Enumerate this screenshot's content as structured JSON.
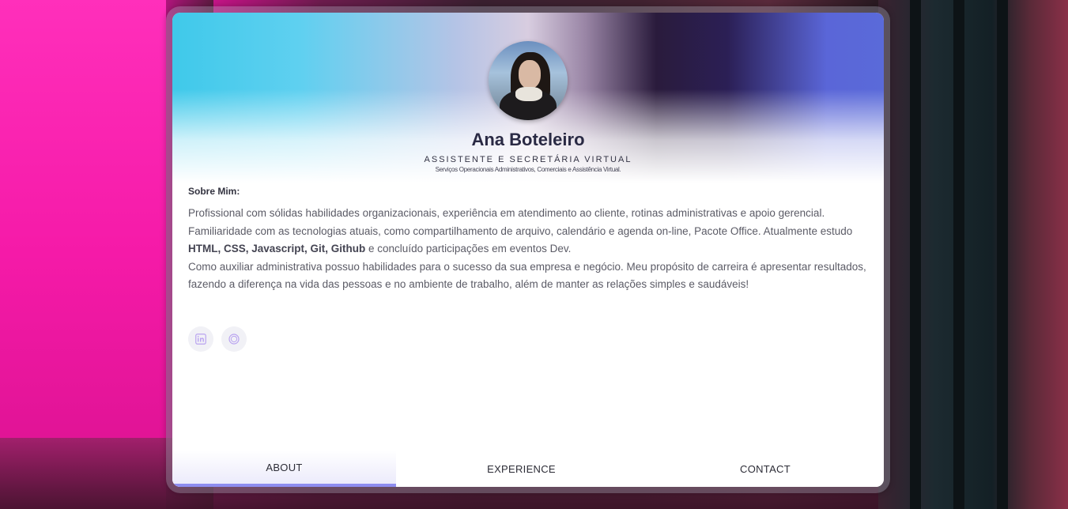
{
  "profile": {
    "name": "Ana Boteleiro",
    "role": "ASSISTENTE E SECRETÁRIA VIRTUAL",
    "tagline": "Serviços Operacionais Administrativos, Comerciais e Assistência Virtual."
  },
  "about": {
    "title": "Sobre Mim:",
    "p1": "Profissional com sólidas habilidades organizacionais, experiência em atendimento ao cliente, rotinas administrativas e apoio gerencial.",
    "p2_start": "Familiaridade com as tecnologias atuais, como compartilhamento de arquivo, calendário e agenda on-line, Pacote Office. Atualmente estudo ",
    "p2_bold": "HTML, CSS, Javascript, Git, Github",
    "p2_end": " e concluído participações em eventos Dev.",
    "p3": "Como auxiliar administrativa possuo habilidades para o sucesso da sua empresa e negócio. Meu propósito de carreira é apresentar resultados, fazendo a diferença na vida das pessoas e no ambiente de trabalho, além de manter as relações simples e saudáveis!"
  },
  "socials": [
    {
      "icon": "linkedin-icon"
    },
    {
      "icon": "instagram-icon"
    }
  ],
  "tabs": [
    {
      "label": "ABOUT",
      "active": true
    },
    {
      "label": "EXPERIENCE",
      "active": false
    },
    {
      "label": "CONTACT",
      "active": false
    }
  ],
  "colors": {
    "accent": "#8e8df0",
    "social_icon": "#b9a3f0"
  }
}
